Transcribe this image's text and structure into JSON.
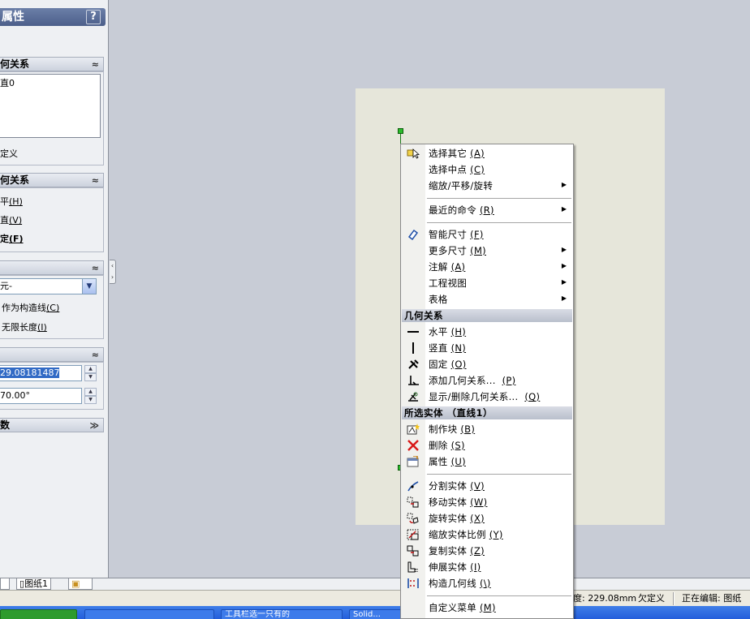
{
  "panel": {
    "title": "属性",
    "help": "?",
    "groups": [
      {
        "label": "何关系",
        "chevron": "≈",
        "items": [
          "直0"
        ],
        "footer": "定义"
      },
      {
        "label": "何关系",
        "chevron": "≈",
        "options": [
          {
            "text": "平",
            "key": "(H)"
          },
          {
            "text": "直",
            "key": "(V)"
          },
          {
            "text": "定",
            "key": "(F)"
          }
        ]
      },
      {
        "label": "",
        "chevron": "≈",
        "select_value": "元-",
        "checks": [
          {
            "text": "作为构造线",
            "key": "(C)"
          },
          {
            "text": "无限长度",
            "key": "(I)"
          }
        ]
      },
      {
        "label": "",
        "chevron": "≈",
        "length_value": "29.08181487",
        "angle_value": "70.00°"
      },
      {
        "label": "数",
        "chevron": "≫"
      }
    ]
  },
  "tabs": {
    "model": "",
    "sheet": "图纸1"
  },
  "status": {
    "length": "度: 229.08mm",
    "state": "欠定义",
    "editing": "正在编辑: 图纸"
  },
  "taskbar": [
    "",
    "",
    "工具栏选一只有的",
    "Solid..."
  ],
  "menu": {
    "items": [
      {
        "label": "选择其它",
        "key": "(A)",
        "icon": "select-other-icon"
      },
      {
        "label": "选择中点",
        "key": "(C)"
      },
      {
        "label": "缩放/平移/旋转",
        "submenu": true
      },
      {
        "sep": true
      },
      {
        "label": "最近的命令",
        "key": "(R)",
        "submenu": true
      },
      {
        "sep": true
      },
      {
        "label": "智能尺寸",
        "key": "(F)",
        "icon": "smart-dimension-icon"
      },
      {
        "label": "更多尺寸",
        "key": "(M)",
        "submenu": true
      },
      {
        "label": "注解",
        "key": "(A)",
        "submenu": true
      },
      {
        "label": "工程视图",
        "submenu": true
      },
      {
        "label": "表格",
        "submenu": true
      },
      {
        "header": "几何关系"
      },
      {
        "label": "水平",
        "key": "(H)",
        "icon": "horizontal-icon"
      },
      {
        "label": "竖直",
        "key": "(N)",
        "icon": "vertical-icon"
      },
      {
        "label": "固定",
        "key": "(O)",
        "icon": "fix-icon"
      },
      {
        "label": "添加几何关系...",
        "key": "(P)",
        "icon": "add-relation-icon"
      },
      {
        "label": "显示/删除几何关系...",
        "key": "(Q)",
        "icon": "display-delete-relations-icon"
      },
      {
        "header": "所选实体 （直线1）"
      },
      {
        "label": "制作块",
        "key": "(B)",
        "icon": "make-block-icon"
      },
      {
        "label": "删除",
        "key": "(S)",
        "icon": "delete-icon"
      },
      {
        "label": "属性",
        "key": "(U)",
        "icon": "properties-icon"
      },
      {
        "sep": true
      },
      {
        "label": "分割实体",
        "key": "(V)",
        "icon": "split-entity-icon"
      },
      {
        "label": "移动实体",
        "key": "(W)",
        "icon": "move-entity-icon"
      },
      {
        "label": "旋转实体",
        "key": "(X)",
        "icon": "rotate-entity-icon"
      },
      {
        "label": "缩放实体比例",
        "key": "(Y)",
        "icon": "scale-entity-icon"
      },
      {
        "label": "复制实体",
        "key": "(Z)",
        "icon": "copy-entity-icon"
      },
      {
        "label": "伸展实体",
        "key": "(I)",
        "icon": "stretch-entity-icon"
      },
      {
        "label": "构造几何线",
        "key": "(\\)",
        "icon": "construction-geometry-icon"
      },
      {
        "sep": true
      },
      {
        "label": "自定义菜单",
        "key": "(M)"
      }
    ]
  },
  "colors": {
    "sheet": "#e6e6da",
    "canvas": "#c8ccd6",
    "endpoint": "#2bbb2b",
    "line": "#1a7a1a"
  }
}
